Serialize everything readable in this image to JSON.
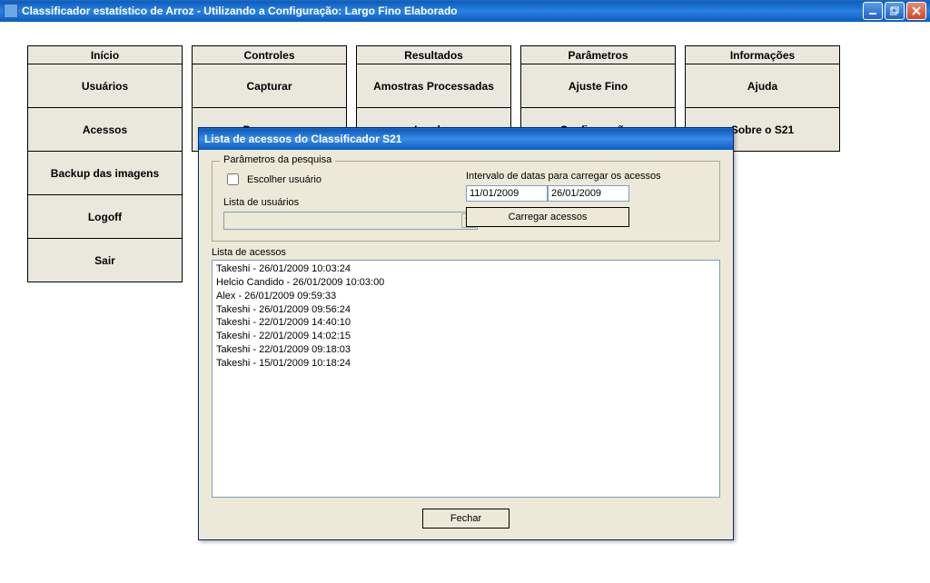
{
  "main_title": "Classificador estatístico de Arroz - Utilizando a Configuração: Largo Fino Elaborado",
  "menus": [
    {
      "header": "Início",
      "items": [
        "Usuários",
        "Acessos",
        "Backup das imagens",
        "Logoff",
        "Sair"
      ]
    },
    {
      "header": "Controles",
      "items": [
        "Capturar",
        "Processar"
      ]
    },
    {
      "header": "Resultados",
      "items": [
        "Amostras Processadas",
        "Laudos"
      ]
    },
    {
      "header": "Parâmetros",
      "items": [
        "Ajuste Fino",
        "Configurações"
      ]
    },
    {
      "header": "Informações",
      "items": [
        "Ajuda",
        "Sobre o S21"
      ]
    }
  ],
  "dialog": {
    "title": "Lista de acessos do Classificador S21",
    "group_title": "Parâmetros da pesquisa",
    "choose_user_label": "Escolher usuário",
    "user_list_label": "Lista de usuários",
    "date_interval_label": "Intervalo de datas para carregar os acessos",
    "date_from": "11/01/2009",
    "date_to": "26/01/2009",
    "load_button": "Carregar acessos",
    "list_label": "Lista de acessos",
    "close_button": "Fechar",
    "access_list": [
      "Takeshi - 26/01/2009 10:03:24",
      "Helcio Candido - 26/01/2009 10:03:00",
      "Alex - 26/01/2009 09:59:33",
      "Takeshi - 26/01/2009 09:56:24",
      "Takeshi - 22/01/2009 14:40:10",
      "Takeshi - 22/01/2009 14:02:15",
      "Takeshi - 22/01/2009 09:18:03",
      "Takeshi - 15/01/2009 10:18:24"
    ]
  }
}
